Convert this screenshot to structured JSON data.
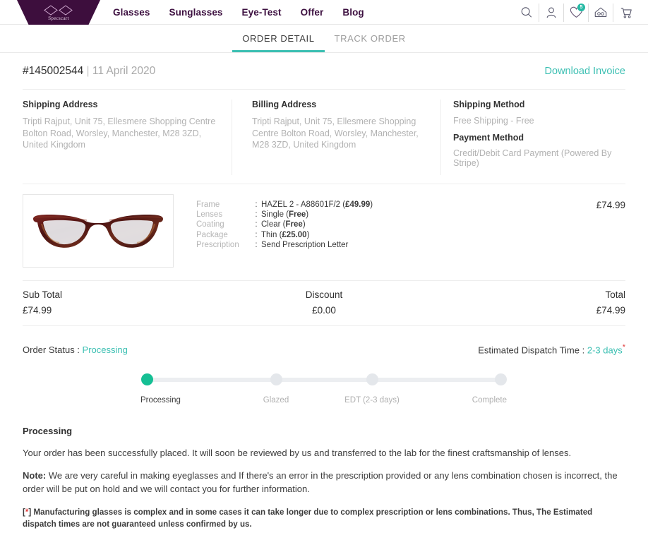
{
  "header": {
    "logo_text": "Specscart",
    "nav": [
      {
        "label": "Glasses"
      },
      {
        "label": "Sunglasses"
      },
      {
        "label": "Eye-Test"
      },
      {
        "label": "Offer"
      },
      {
        "label": "Blog"
      }
    ],
    "icons": [
      {
        "name": "search-icon"
      },
      {
        "name": "user-icon"
      },
      {
        "name": "wishlist-heart-icon",
        "badge": "5"
      },
      {
        "name": "home-glasses-icon"
      },
      {
        "name": "cart-icon"
      }
    ],
    "accent_color": "#3bbfb2",
    "brand_color": "#3d0e3d"
  },
  "tabs": [
    {
      "label": "ORDER DETAIL",
      "active": true
    },
    {
      "label": "TRACK ORDER",
      "active": false
    }
  ],
  "order": {
    "number": "#145002544",
    "separator": "|",
    "date": "11 April 2020",
    "download_invoice_label": "Download Invoice"
  },
  "addresses": {
    "shipping": {
      "title": "Shipping Address",
      "body": "Tripti Rajput, Unit 75, Ellesmere Shopping Centre Bolton Road, Worsley, Manchester, M28 3ZD, United Kingdom"
    },
    "billing": {
      "title": "Billing Address",
      "body": "Tripti Rajput, Unit 75, Ellesmere Shopping Centre Bolton Road, Worsley, Manchester, M28 3ZD, United Kingdom"
    },
    "shipping_method": {
      "title": "Shipping Method",
      "value": "Free Shipping - Free"
    },
    "payment_method": {
      "title": "Payment Method",
      "value": "Credit/Debit Card Payment (Powered By Stripe)"
    }
  },
  "product": {
    "image_alt": "tortoiseshell-eyeglasses-frame",
    "price": "£74.99",
    "specs": [
      {
        "label": "Frame",
        "colon": ":",
        "value": "HAZEL 2 - A88601F/2 (",
        "bold": "£49.99",
        "tail": ")"
      },
      {
        "label": "Lenses",
        "colon": ":",
        "value": "Single (",
        "bold": "Free",
        "tail": ")"
      },
      {
        "label": "Coating",
        "colon": ":",
        "value": "Clear (",
        "bold": "Free",
        "tail": ")"
      },
      {
        "label": "Package",
        "colon": ":",
        "value": "Thin (",
        "bold": "£25.00",
        "tail": ")"
      },
      {
        "label": "Prescription",
        "colon": ":",
        "value": "Send Prescription Letter",
        "bold": "",
        "tail": ""
      }
    ]
  },
  "totals": {
    "sub_total_label": "Sub Total",
    "sub_total_value": "£74.99",
    "discount_label": "Discount",
    "discount_value": "£0.00",
    "total_label": "Total",
    "total_value": "£74.99"
  },
  "status": {
    "order_status_label": "Order Status :",
    "order_status_value": "Processing",
    "edt_label": "Estimated Dispatch Time :",
    "edt_value": "2-3 days",
    "edt_asterisk": "*"
  },
  "progress": {
    "steps": [
      {
        "label": "Processing",
        "done": true
      },
      {
        "label": "Glazed",
        "done": false
      },
      {
        "label": "EDT (2-3 days)",
        "done": false
      },
      {
        "label": "Complete",
        "done": false
      }
    ]
  },
  "notes": {
    "heading": "Processing",
    "paragraph": "Your order has been successfully placed. It will soon be reviewed by us and transferred to the lab for the finest craftsmanship of lenses.",
    "note_label": "Note:",
    "note_text": " We are very careful in making eyeglasses and If there's an error in the prescription provided or any lens combination chosen is incorrect, the order will be put on hold and we will contact you for further information.",
    "disclaimer_open": "[",
    "disclaimer_ast": "*",
    "disclaimer_close": "] Manufacturing glasses is complex and in some cases it can take longer due to complex prescription or lens combinations. Thus, The Estimated dispatch times are not guaranteed unless confirmed by us."
  }
}
